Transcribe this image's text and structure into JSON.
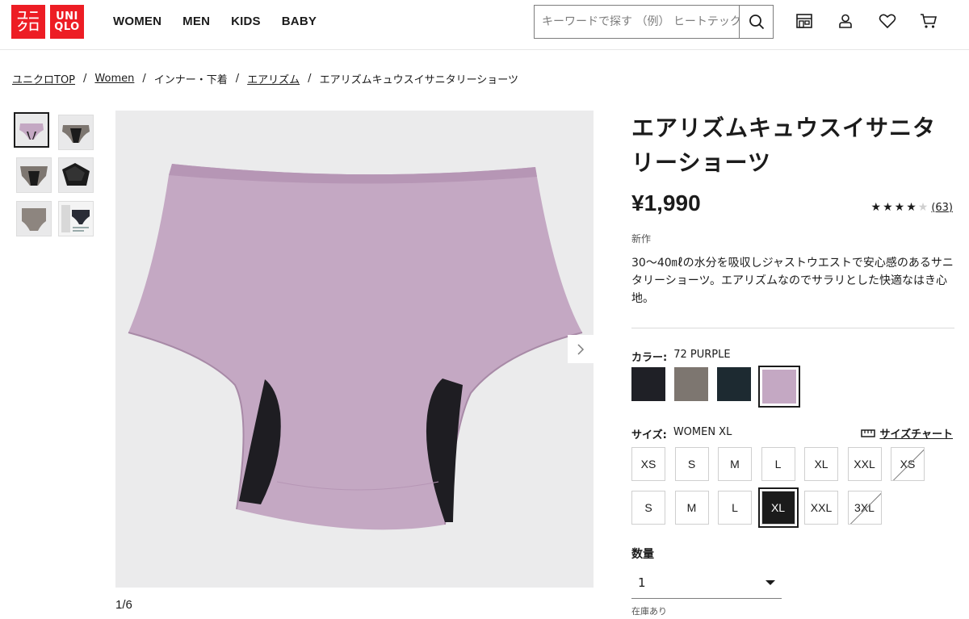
{
  "header": {
    "logo_jp": [
      "ユニ",
      "クロ"
    ],
    "logo_en": [
      "UNI",
      "QLO"
    ],
    "nav": [
      "WOMEN",
      "MEN",
      "KIDS",
      "BABY"
    ],
    "search_placeholder": "キーワードで探す （例） ヒートテック",
    "icons": [
      "store-icon",
      "account-icon",
      "wishlist-heart-icon",
      "cart-icon"
    ],
    "brand_color": "#ed1d24"
  },
  "breadcrumb": [
    "ユニクロTOP",
    "Women",
    "インナー・下着",
    "エアリズム",
    "エアリズムキュウスイサニタリーショーツ"
  ],
  "gallery": {
    "counter": "1/6",
    "thumbnail_count": 6,
    "active_thumbnail": 1
  },
  "product": {
    "title": "エアリズムキュウスイサニタリーショーツ",
    "price": "¥1,990",
    "rating": 4,
    "rating_max": 5,
    "rating_count": "(63)",
    "badge": "新作",
    "description": "30〜40㎖の水分を吸収しジャストウエストで安心感のあるサニタリーショーツ。エアリズムなのでサラリとした快適なはき心地。"
  },
  "color": {
    "label": "カラー:",
    "value": "72 PURPLE",
    "swatches": [
      {
        "name": "black",
        "hex": "#1f2026"
      },
      {
        "name": "gray",
        "hex": "#7d7670"
      },
      {
        "name": "navy",
        "hex": "#1d2a31"
      },
      {
        "name": "purple",
        "hex": "#c4a8c3",
        "selected": true
      }
    ]
  },
  "size": {
    "label": "サイズ:",
    "value": "WOMEN XL",
    "chart_label": "サイズチャート",
    "row1": [
      {
        "label": "XS"
      },
      {
        "label": "S"
      },
      {
        "label": "M"
      },
      {
        "label": "L"
      },
      {
        "label": "XL"
      },
      {
        "label": "XXL"
      },
      {
        "label": "XS",
        "disabled": true
      }
    ],
    "row2": [
      {
        "label": "S"
      },
      {
        "label": "M"
      },
      {
        "label": "L"
      },
      {
        "label": "XL",
        "selected": true
      },
      {
        "label": "XXL"
      },
      {
        "label": "3XL",
        "disabled": true
      }
    ]
  },
  "quantity": {
    "label": "数量",
    "value": "1",
    "stock": "在庫あり"
  }
}
